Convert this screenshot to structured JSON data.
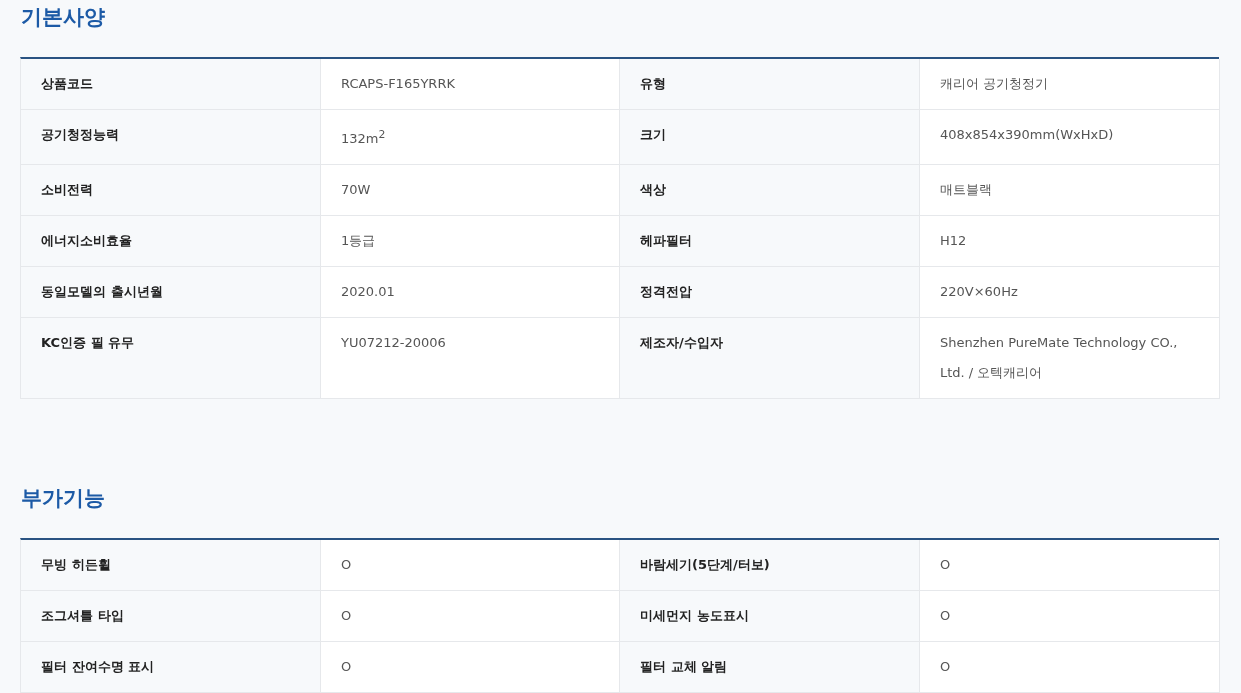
{
  "sections": [
    {
      "title": "기본사양",
      "items": [
        {
          "label": "상품코드",
          "value": "RCAPS-F165YRRK"
        },
        {
          "label": "유형",
          "value": "캐리어 공기청정기"
        },
        {
          "label": "공기청정능력",
          "value": "132m$^{2}$"
        },
        {
          "label": "크기",
          "value": "408x854x390mm(WxHxD)"
        },
        {
          "label": "소비전력",
          "value": "70W"
        },
        {
          "label": "색상",
          "value": "매트블랙"
        },
        {
          "label": "에너지소비효율",
          "value": "1등급"
        },
        {
          "label": "헤파필터",
          "value": "H12"
        },
        {
          "label": "동일모델의 출시년월",
          "value": "2020.01"
        },
        {
          "label": "정격전압",
          "value": "220V×60Hz"
        },
        {
          "label": "KC인증 필 유무",
          "value": "YU07212-20006"
        },
        {
          "label": "제조자/수입자",
          "value": "Shenzhen PureMate Technology CO., Ltd. / 오텍캐리어"
        }
      ]
    },
    {
      "title": "부가기능",
      "items": [
        {
          "label": "무빙 히든휠",
          "value": "O"
        },
        {
          "label": "바람세기(5단계/터보)",
          "value": "O"
        },
        {
          "label": "조그셔틀 타입",
          "value": "O"
        },
        {
          "label": "미세먼지 농도표시",
          "value": "O"
        },
        {
          "label": "필터 잔여수명 표시",
          "value": "O"
        },
        {
          "label": "필터 교체 알림",
          "value": "O"
        }
      ]
    }
  ]
}
